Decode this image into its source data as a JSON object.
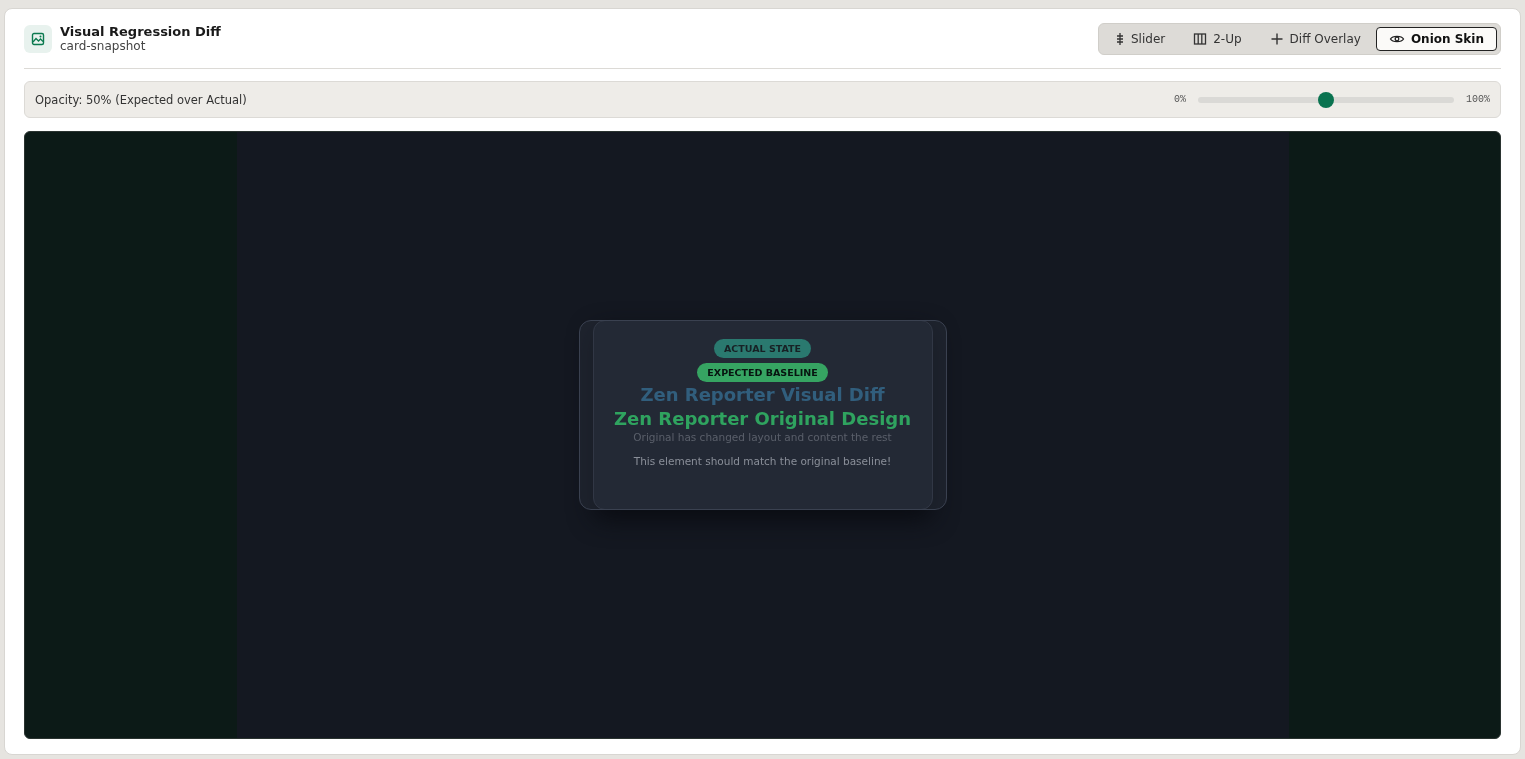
{
  "header": {
    "title": "Visual Regression Diff",
    "subtitle": "card-snapshot"
  },
  "modes": [
    {
      "label": "Slider",
      "selected": false
    },
    {
      "label": "2-Up",
      "selected": false
    },
    {
      "label": "Diff Overlay",
      "selected": false
    },
    {
      "label": "Onion Skin",
      "selected": true
    }
  ],
  "opacity_bar": {
    "label": "Opacity: 50% (Expected over Actual)",
    "min_label": "0%",
    "max_label": "100%",
    "level": 0.5
  },
  "layers": [
    {
      "kind": "actual",
      "badge": "ACTUAL STATE",
      "title": "Zen Reporter Visual Diff",
      "description": "Original has changed layout and content the rest"
    },
    {
      "kind": "expected",
      "badge": "EXPECTED BASELINE",
      "title": "Zen Reporter Original Design",
      "description": "This element should match the original baseline!"
    }
  ]
}
